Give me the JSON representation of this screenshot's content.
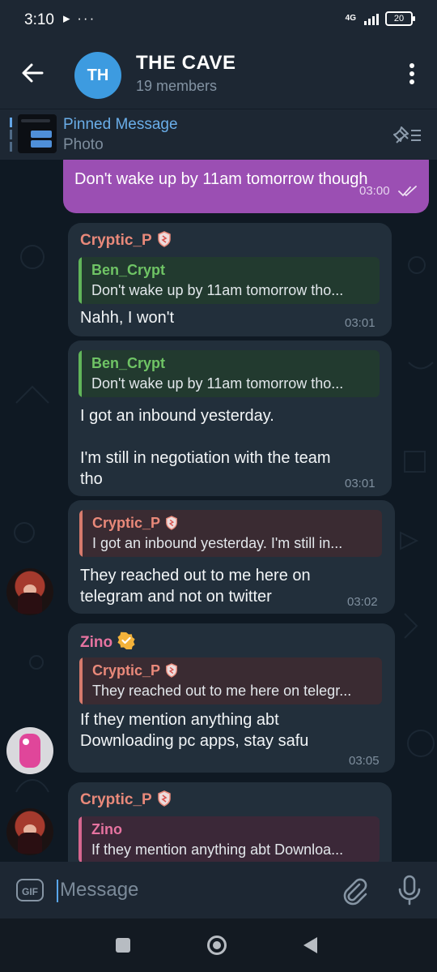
{
  "status": {
    "time": "3:10",
    "icons": "▸ ···",
    "network": "4G",
    "battery": "20"
  },
  "chat": {
    "avatar_initials": "TH",
    "title": "THE CAVE",
    "subtitle": "19 members"
  },
  "pinned": {
    "title": "Pinned Message",
    "text": "Photo"
  },
  "messages": [
    {
      "text": "Don't wake up by 11am tomorrow though",
      "time": "03:00"
    },
    {
      "sender": "Cryptic_P",
      "reply_name": "Ben_Crypt",
      "reply_text": "Don't wake up by 11am tomorrow tho...",
      "text": "Nahh, I won't",
      "time": "03:01"
    },
    {
      "reply_name": "Ben_Crypt",
      "reply_text": "Don't wake up by 11am tomorrow tho...",
      "text": "I got an inbound yesterday.\n\nI'm still in negotiation with the team tho",
      "time": "03:01"
    },
    {
      "reply_name": "Cryptic_P",
      "reply_text": "I got an inbound yesterday.  I'm still in...",
      "text": "They reached out to me here on telegram and not on twitter",
      "time": "03:02"
    },
    {
      "sender": "Zino",
      "reply_name": "Cryptic_P",
      "reply_text": "They reached out to me here on telegr...",
      "text": "If they mention anything abt Downloading pc apps, stay safu",
      "time": "03:05"
    },
    {
      "sender": "Cryptic_P",
      "reply_name": "Zino",
      "reply_text": "If they mention anything abt Downloa..."
    }
  ],
  "composer": {
    "gif_label": "GIF",
    "placeholder": "Message"
  },
  "colors": {
    "header": "#1d2733",
    "outgoing": "#9b4fb3",
    "incoming": "#222f3b",
    "accent": "#63a6e8"
  }
}
